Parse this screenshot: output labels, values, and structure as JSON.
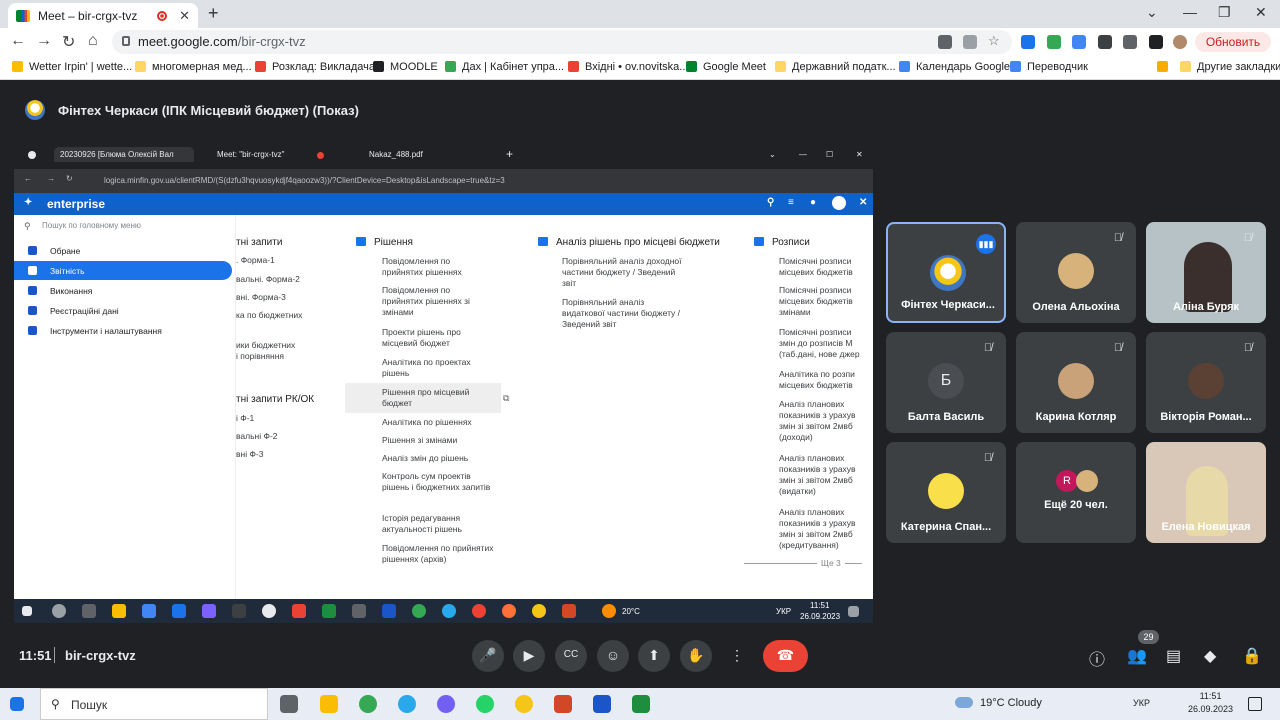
{
  "browser": {
    "tab_title": "Meet – bir-crgx-tvz",
    "url_host": "meet.google.com",
    "url_path": "/bir-crgx-tvz",
    "update_button": "Обновить",
    "bookmarks": [
      "Wetter Irpin' | wette...",
      "многомерная мед...",
      "Розклад: Викладача",
      "MOODLE",
      "Дах | Кабінет упра...",
      "Вхідні • ov.novitska...",
      "Google Meet",
      "Державний податк...",
      "Календарь Google",
      "Переводчик",
      "Другие закладки"
    ]
  },
  "meet": {
    "presentation_title": "Фінтех Черкаси (ІПК Місцевий бюджет) (Показ)",
    "time": "11:51",
    "meeting_code": "bir-crgx-tvz",
    "participants_count": "29",
    "participants": [
      {
        "name": "Фінтех Черкаси...",
        "speaking": true
      },
      {
        "name": "Олена Альохіна",
        "muted": true
      },
      {
        "name": "Аліна Буряк",
        "muted": true
      },
      {
        "name": "Балта Василь",
        "initial": "Б",
        "muted": true
      },
      {
        "name": "Карина Котляр",
        "muted": true
      },
      {
        "name": "Вікторія Роман...",
        "muted": true
      },
      {
        "name": "Катерина Спан...",
        "muted": true
      },
      {
        "name": "Ещё 20 чел.",
        "initial": "R"
      },
      {
        "name": "Елена Новицкая"
      }
    ]
  },
  "shared_screen": {
    "tabs": [
      "20230926 [Блюма Олексій Вал",
      "Meet: \"bir-crgx-tvz\"",
      "Nakaz_488.pdf"
    ],
    "url": "logica.minfin.gov.ua/clientRMD/(S(dzfu3hqvuosykdjf4qaoozw3))/?ClientDevice=Desktop&isLandscape=true&tz=3",
    "app_name": "enterprise",
    "search_placeholder": "Пошук по головному меню",
    "sidebar": [
      "Обране",
      "Звітність",
      "Виконання",
      "Реєстраційні дані",
      "Інструменти і налаштування"
    ],
    "col1_header": "тні запити",
    "col1_items": [
      ". Форма-1",
      "вальні. Форма-2",
      "вні. Форма-3",
      "ка по бюджетних",
      "ики бюджетних",
      "і порівняння",
      "тні запити РК/ОК",
      "і Ф-1",
      "вальні Ф-2",
      "вні Ф-3"
    ],
    "col2_header": "Рішення",
    "col2_items": [
      "Повідомлення по прийнятих рішеннях",
      "Повідомлення по прийнятих рішеннях зі змінами",
      "Проекти рішень про місцевий бюджет",
      "Аналітика по проектах рішень",
      "Рішення про місцевий бюджет",
      "Аналітика по рішеннях",
      "Рішення зі змінами",
      "Аналіз змін до рішень",
      "Контроль сум проектів рішень і бюджетних запитів",
      "Історія редагування актуальності рішень",
      "Повідомлення по прийнятих рішеннях (архів)"
    ],
    "col3_header": "Аналіз рішень про місцеві бюджети",
    "col3_items": [
      "Порівняльний аналіз доходної частини бюджету / Зведений звіт",
      "Порівняльний аналіз видаткової частини бюджету / Зведений звіт"
    ],
    "col4_header": "Розписи",
    "col4_items": [
      "Помісячні розписи місцевих бюджетів",
      "Помісячні розписи місцевих бюджетів змінами",
      "Помісячні розписи змін до розписів М (таб.дані, нове джер",
      "Аналітика по розпи місцевих бюджетів",
      "Аналіз планових показників з урахув змін зі звітом 2мвб (доходи)",
      "Аналіз планових показників з урахув змін зі звітом 2мвб (видатки)",
      "Аналіз планових показників з урахув змін зі звітом 2мвб (кредитування)"
    ],
    "more_label": "Ще 3",
    "taskbar_temp": "20°C",
    "taskbar_lang": "УКР",
    "taskbar_time": "11:51",
    "taskbar_date": "26.09.2023"
  },
  "windows": {
    "search_placeholder": "Пошук",
    "weather": "19°C  Cloudy",
    "lang": "УКР",
    "time": "11:51",
    "date": "26.09.2023"
  }
}
